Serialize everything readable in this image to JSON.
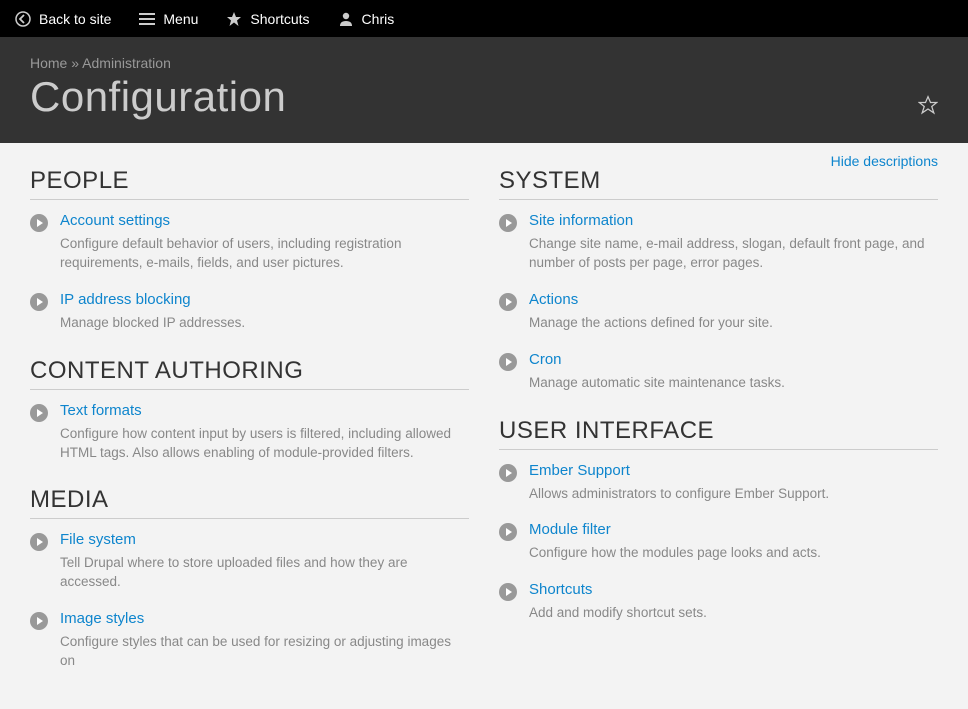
{
  "toolbar": {
    "back": "Back to site",
    "menu": "Menu",
    "shortcuts": "Shortcuts",
    "user": "Chris"
  },
  "breadcrumb": {
    "home": "Home",
    "sep": " » ",
    "admin": "Administration"
  },
  "page_title": "Configuration",
  "hide_descriptions": "Hide descriptions",
  "left": [
    {
      "title": "PEOPLE",
      "items": [
        {
          "link": "Account settings",
          "desc": "Configure default behavior of users, including registration requirements, e-mails, fields, and user pictures."
        },
        {
          "link": "IP address blocking",
          "desc": "Manage blocked IP addresses."
        }
      ]
    },
    {
      "title": "CONTENT AUTHORING",
      "items": [
        {
          "link": "Text formats",
          "desc": "Configure how content input by users is filtered, including allowed HTML tags. Also allows enabling of module-provided filters."
        }
      ]
    },
    {
      "title": "MEDIA",
      "items": [
        {
          "link": "File system",
          "desc": "Tell Drupal where to store uploaded files and how they are accessed."
        },
        {
          "link": "Image styles",
          "desc": "Configure styles that can be used for resizing or adjusting images on"
        }
      ]
    }
  ],
  "right": [
    {
      "title": "SYSTEM",
      "items": [
        {
          "link": "Site information",
          "desc": "Change site name, e-mail address, slogan, default front page, and number of posts per page, error pages."
        },
        {
          "link": "Actions",
          "desc": "Manage the actions defined for your site."
        },
        {
          "link": "Cron",
          "desc": "Manage automatic site maintenance tasks."
        }
      ]
    },
    {
      "title": "USER INTERFACE",
      "items": [
        {
          "link": "Ember Support",
          "desc": "Allows administrators to configure Ember Support."
        },
        {
          "link": "Module filter",
          "desc": "Configure how the modules page looks and acts."
        },
        {
          "link": "Shortcuts",
          "desc": "Add and modify shortcut sets."
        }
      ]
    }
  ]
}
